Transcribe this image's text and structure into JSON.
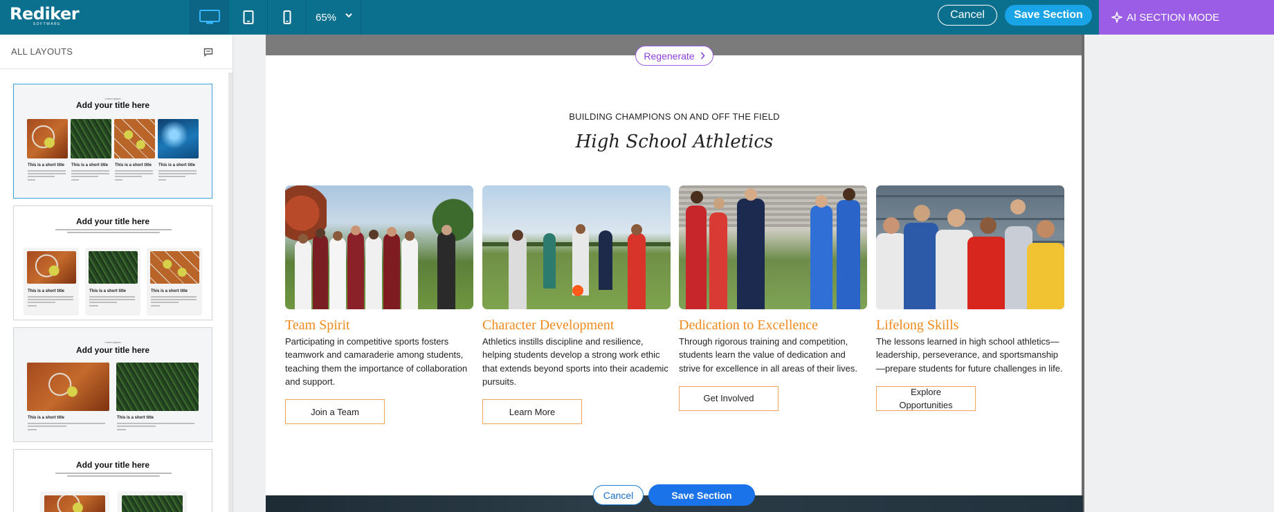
{
  "app": {
    "logo_text": "Rediker",
    "logo_subtext": "SOFTWARE",
    "zoom_value": "65%",
    "cancel_label": "Cancel",
    "save_label": "Save Section",
    "ai_mode_label": "AI SECTION MODE",
    "accent_colors": {
      "topbar": "#0b6f8e",
      "ai": "#9b5de5",
      "save": "#1aa4e8",
      "orange": "#f08a1c"
    }
  },
  "sidebar": {
    "heading": "ALL LAYOUTS",
    "cards": [
      {
        "title": "Add your title here",
        "kicker": "Lorem ipsum",
        "item_title": "This is a short title"
      },
      {
        "title": "Add your title here",
        "item_title": "This is a short title"
      },
      {
        "title": "Add your title here",
        "kicker": "Lorem ipsum",
        "item_title": "This is a short title"
      },
      {
        "title": "Add your title here"
      }
    ]
  },
  "editor": {
    "regenerate_label": "Regenerate",
    "kicker": "BUILDING CHAMPIONS ON AND OFF THE FIELD",
    "heading": "High School Athletics",
    "columns": [
      {
        "title": "Team Spirit",
        "text": "Participating in competitive sports fosters teamwork and camaraderie among students, teaching them the importance of collaboration and support.",
        "button": "Join a Team"
      },
      {
        "title": "Character Development",
        "text": "Athletics instills discipline and resilience, helping students develop a strong work ethic that extends beyond sports into their academic pursuits.",
        "button": "Learn More"
      },
      {
        "title": "Dedication to Excellence",
        "text": "Through rigorous training and competition, students learn the value of dedication and strive for excellence in all areas of their lives.",
        "button": "Get Involved"
      },
      {
        "title": "Lifelong Skills",
        "text": "The lessons learned in high school athletics—leadership, perseverance, and sportsmanship—prepare students for future challenges in life.",
        "button": "Explore Opportunities"
      }
    ],
    "bottom_cancel_label": "Cancel",
    "bottom_save_label": "Save Section"
  }
}
